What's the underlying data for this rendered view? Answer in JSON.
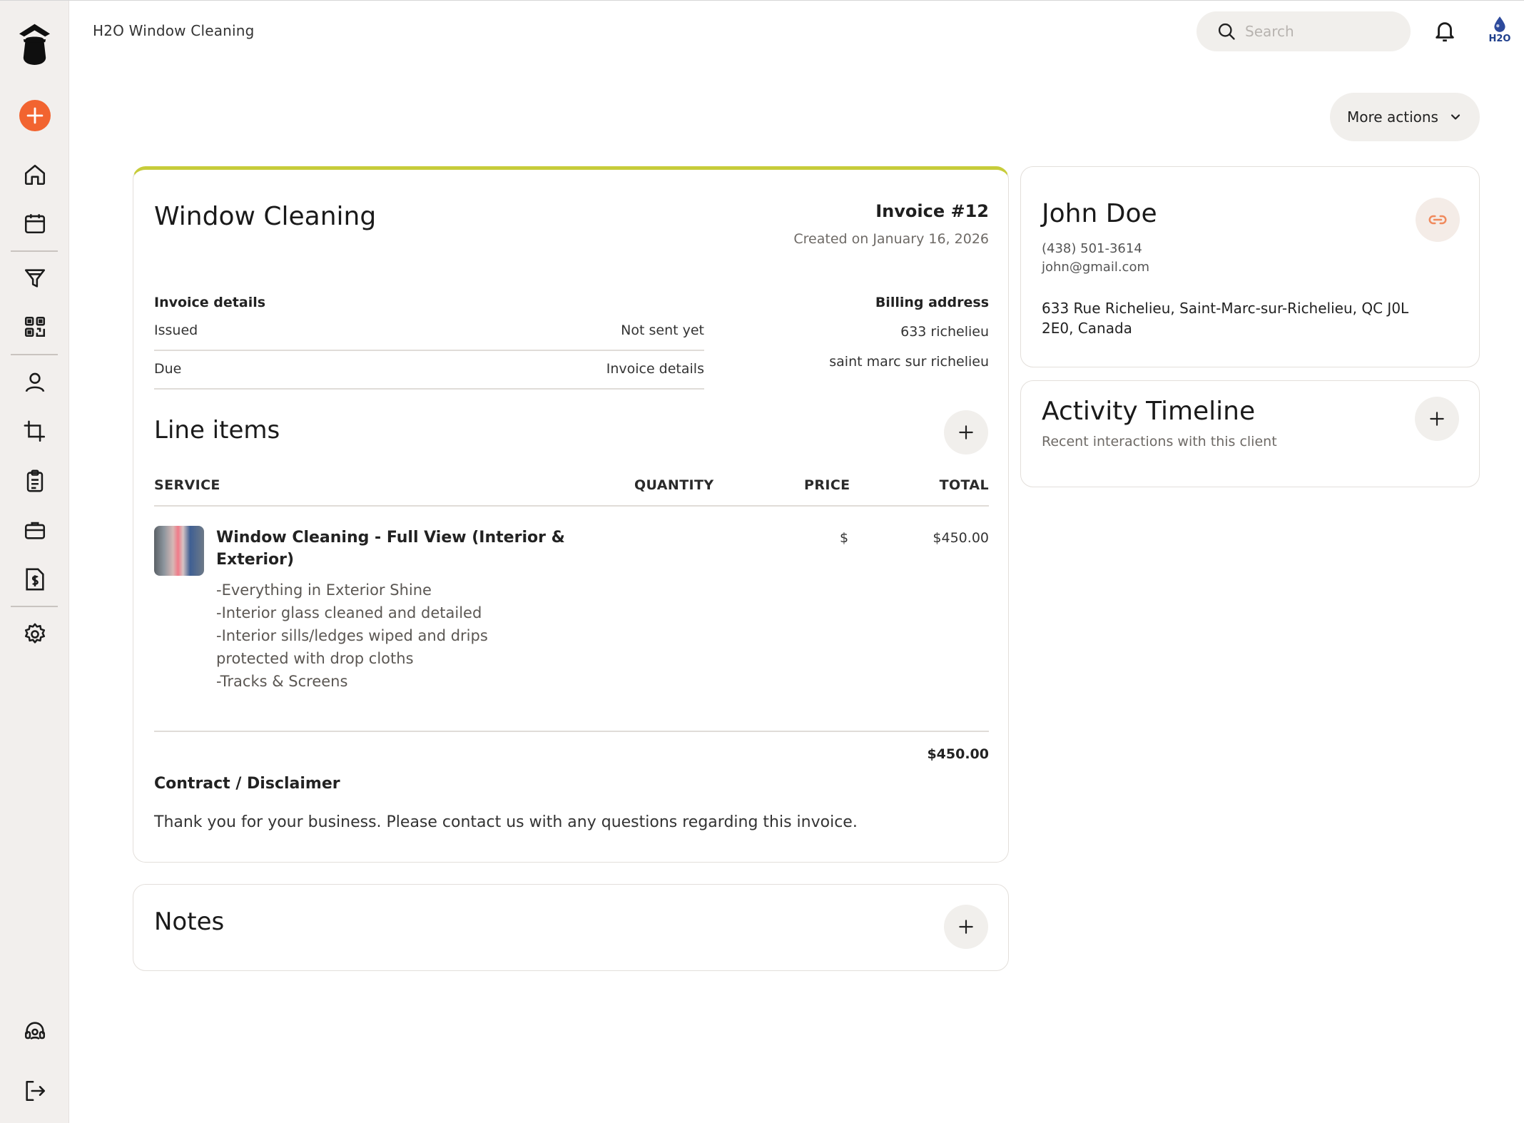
{
  "app": {
    "title": "H2O Window Cleaning",
    "logo_text": "H2O"
  },
  "search": {
    "placeholder": "Search"
  },
  "toolbar": {
    "more_actions_label": "More actions"
  },
  "sidebar": {
    "items": [
      {
        "icon": "plus-circle-icon"
      },
      {
        "icon": "home-icon"
      },
      {
        "icon": "calendar-icon"
      },
      {
        "icon": "funnel-icon"
      },
      {
        "icon": "qr-code-icon"
      },
      {
        "icon": "user-icon"
      },
      {
        "icon": "crop-icon"
      },
      {
        "icon": "clipboard-icon"
      },
      {
        "icon": "briefcase-icon"
      },
      {
        "icon": "invoice-dollar-icon"
      },
      {
        "icon": "gear-icon"
      },
      {
        "icon": "support-icon"
      },
      {
        "icon": "logout-icon"
      }
    ]
  },
  "invoice": {
    "title": "Window Cleaning",
    "number": "Invoice #12",
    "created": "Created on January 16, 2026",
    "details_heading": "Invoice details",
    "issued_label": "Issued",
    "issued_value": "Not sent yet",
    "due_label": "Due",
    "due_value": "Invoice details",
    "billing_heading": "Billing address",
    "billing_line1": "633 richelieu",
    "billing_line2": "saint marc sur richelieu",
    "line_items_heading": "Line items",
    "columns": {
      "service": "SERVICE",
      "quantity": "QUANTITY",
      "price": "PRICE",
      "total": "TOTAL"
    },
    "items": [
      {
        "name_line1": "Window Cleaning - Full View (Interior &",
        "name_line2": "Exterior)",
        "description": [
          "-Everything in Exterior Shine",
          "-Interior glass cleaned and detailed",
          "-Interior sills/ledges wiped and drips",
          "protected with drop cloths",
          "-Tracks & Screens"
        ],
        "price": "$",
        "total": "$450.00"
      }
    ],
    "grand_total": "$450.00",
    "contract_heading": "Contract / Disclaimer",
    "contract_text": "Thank you for your business. Please contact us with any questions regarding this invoice."
  },
  "notes": {
    "heading": "Notes"
  },
  "client": {
    "name": "John Doe",
    "phone": "(438) 501-3614",
    "email": "john@gmail.com",
    "address_line1": "633 Rue Richelieu, Saint-Marc-sur-Richelieu, QC J0L",
    "address_line2": "2E0, Canada"
  },
  "activity": {
    "heading": "Activity Timeline",
    "subtitle": "Recent interactions with this client"
  },
  "colors": {
    "accent_orange": "#f26430",
    "accent_lime": "#c7cc3a",
    "link_orange": "#f08a5d"
  }
}
